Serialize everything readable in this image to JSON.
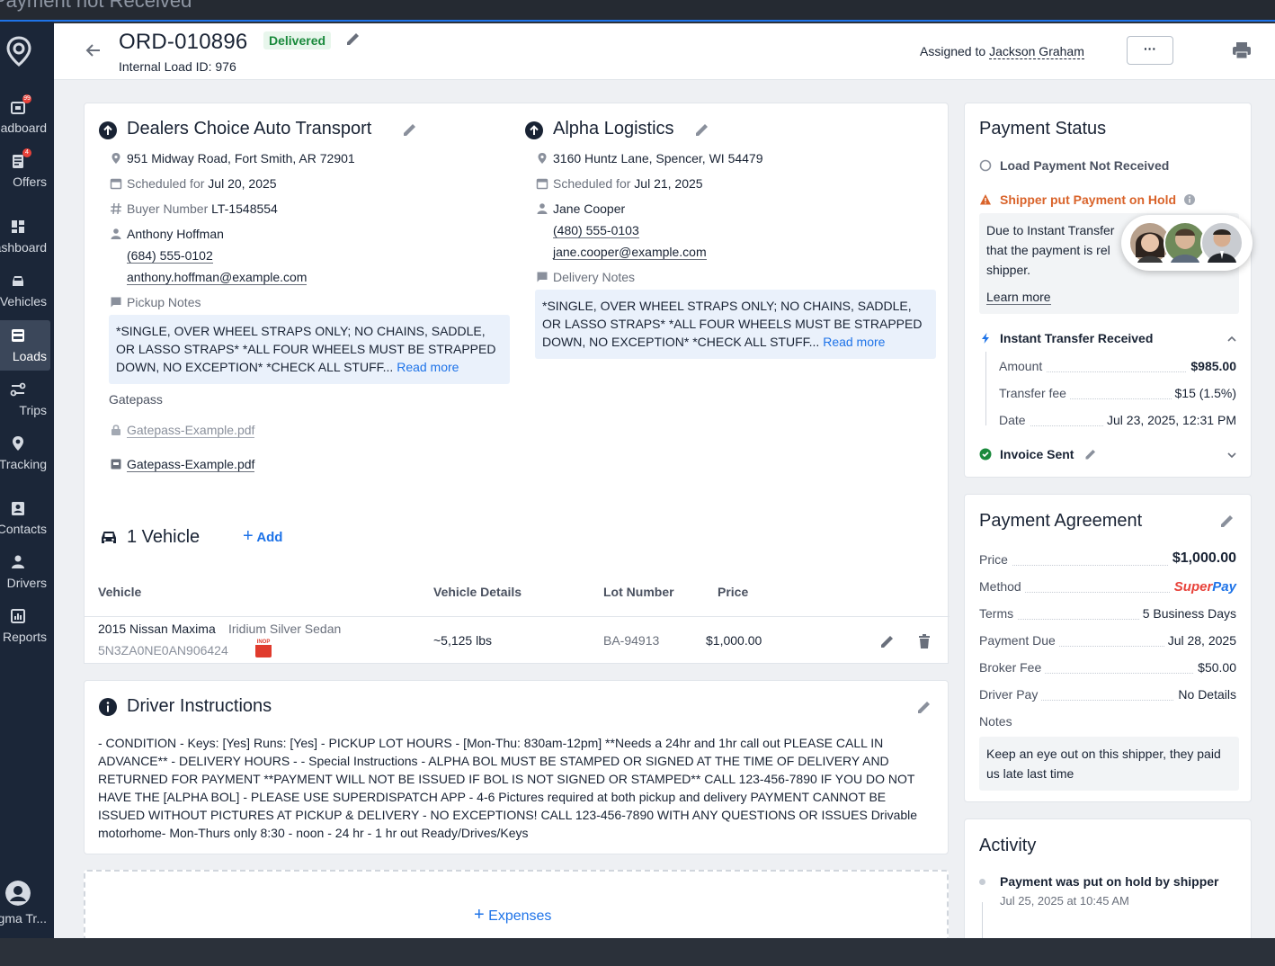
{
  "window": {
    "title": "Payment not Received"
  },
  "sidebar": {
    "items": [
      {
        "label": "Loadboard",
        "badge": "99",
        "icon": "loadboard-icon"
      },
      {
        "label": "Offers",
        "badge": "4",
        "icon": "offers-icon"
      },
      {
        "label": "Dashboard",
        "badge": "",
        "icon": "dashboard-icon"
      },
      {
        "label": "Vehicles",
        "badge": "",
        "icon": "truck-icon"
      },
      {
        "label": "Loads",
        "badge": "",
        "icon": "loads-icon"
      },
      {
        "label": "Trips",
        "badge": "",
        "icon": "trips-icon"
      },
      {
        "label": "Tracking",
        "badge": "",
        "icon": "location-pin-icon"
      },
      {
        "label": "Contacts",
        "badge": "",
        "icon": "contacts-icon"
      },
      {
        "label": "Drivers",
        "badge": "",
        "icon": "driver-icon"
      },
      {
        "label": "Reports",
        "badge": "",
        "icon": "reports-icon"
      }
    ],
    "user_label": "Sigma Tr..."
  },
  "header": {
    "order_id": "ORD-010896",
    "status": "Delivered",
    "internal_load_id": "Internal Load ID: 976",
    "assigned_prefix": "Assigned to",
    "assigned_name": "Jackson Graham",
    "more_label": "···"
  },
  "pickup": {
    "name": "Dealers Choice Auto Transport",
    "address": "951 Midway Road, Fort Smith, AR 72901",
    "scheduled_prefix": "Scheduled for",
    "scheduled_date": "Jul 20, 2025",
    "buyer_prefix": "Buyer Number",
    "buyer_number": "LT-1548554",
    "contact_name": "Anthony Hoffman",
    "phone": "(684) 555-0102",
    "email": "anthony.hoffman@example.com",
    "notes_label": "Pickup Notes",
    "notes_text": "*SINGLE, OVER WHEEL STRAPS ONLY; NO CHAINS, SADDLE, OR LASSO STRAPS* *ALL FOUR WHEELS MUST BE STRAPPED DOWN, NO EXCEPTION* *CHECK ALL STUFF... ",
    "read_more": "Read more",
    "gatepass_label": "Gatepass",
    "gatepass_locked": "Gatepass-Example.pdf",
    "gatepass_file": "Gatepass-Example.pdf"
  },
  "delivery": {
    "name": "Alpha Logistics",
    "address": "3160 Huntz Lane, Spencer, WI 54479",
    "scheduled_prefix": "Scheduled for",
    "scheduled_date": "Jul 21, 2025",
    "contact_name": "Jane Cooper",
    "phone": "(480) 555-0103",
    "email": "jane.cooper@example.com",
    "notes_label": "Delivery Notes",
    "notes_text": "*SINGLE, OVER WHEEL STRAPS ONLY; NO CHAINS, SADDLE, OR LASSO STRAPS* *ALL FOUR WHEELS MUST BE STRAPPED DOWN, NO EXCEPTION* *CHECK ALL STUFF... ",
    "read_more": "Read more"
  },
  "vehicles": {
    "title": "1 Vehicle",
    "add_label": "Add",
    "columns": [
      "Vehicle",
      "Vehicle Details",
      "Lot Number",
      "Price"
    ],
    "rows": [
      {
        "name": "2015 Nissan Maxima",
        "desc": "Iridium Silver Sedan",
        "vin": "5N3ZA0NE0AN906424",
        "inop": "INOP",
        "weight": "~5,125 lbs",
        "lot": "BA-94913",
        "price": "$1,000.00"
      }
    ]
  },
  "driver_instructions": {
    "title": "Driver Instructions",
    "text": "- CONDITION - Keys: [Yes] Runs: [Yes] - PICKUP LOT HOURS - [Mon-Thu: 830am-12pm] **Needs a 24hr and 1hr call out PLEASE CALL IN ADVANCE** - DELIVERY HOURS - - Special Instructions - ALPHA BOL MUST BE STAMPED OR SIGNED AT THE TIME OF DELIVERY AND RETURNED FOR PAYMENT **PAYMENT WILL NOT BE ISSUED IF BOL IS NOT SIGNED OR STAMPED** CALL 123-456-7890 IF YOU DO NOT HAVE THE [ALPHA BOL] - PLEASE USE SUPERDISPATCH APP - 4-6 Pictures required at both pickup and delivery PAYMENT CANNOT BE ISSUED WITHOUT PICTURES AT PICKUP & DELIVERY - NO EXCEPTIONS! CALL 123-456-7890 WITH ANY QUESTIONS OR ISSUES Drivable motorhome- Mon-Thurs only 8:30 - noon - 24 hr - 1 hr out Ready/Drives/Keys"
  },
  "expenses": {
    "label": "Expenses"
  },
  "payment_status": {
    "title": "Payment Status",
    "not_received": "Load Payment Not Received",
    "hold_label": "Shipper put Payment on Hold",
    "hold_text": "Due to Instant Transfer",
    "hold_text2": "that the payment is rel",
    "hold_text3": "shipper.",
    "learn_more": "Learn more",
    "instant_label": "Instant Transfer Received",
    "amount_label": "Amount",
    "amount_value": "$985.00",
    "fee_label": "Transfer fee",
    "fee_value": "$15 (1.5%)",
    "date_label": "Date",
    "date_value": "Jul 23, 2025, 12:31 PM",
    "invoice_label": "Invoice Sent",
    "colors": {
      "warning": "#d9632a",
      "success": "#1a8a3c",
      "accent": "#1e73e8"
    }
  },
  "payment_agreement": {
    "title": "Payment Agreement",
    "price_label": "Price",
    "price_value": "$1,000.00",
    "method_label": "Method",
    "method_value_a": "Super",
    "method_value_b": "Pay",
    "terms_label": "Terms",
    "terms_value": "5 Business Days",
    "due_label": "Payment Due",
    "due_value": "Jul 28, 2025",
    "broker_label": "Broker Fee",
    "broker_value": "$50.00",
    "driver_label": "Driver Pay",
    "driver_value": "No Details",
    "notes_label": "Notes",
    "notes_text": "Keep an eye out on this shipper, they paid us late last time"
  },
  "activity": {
    "title": "Activity",
    "items": [
      {
        "text": "Payment was put on hold by shipper",
        "time": "Jul 25, 2025 at 10:45 AM"
      }
    ]
  }
}
